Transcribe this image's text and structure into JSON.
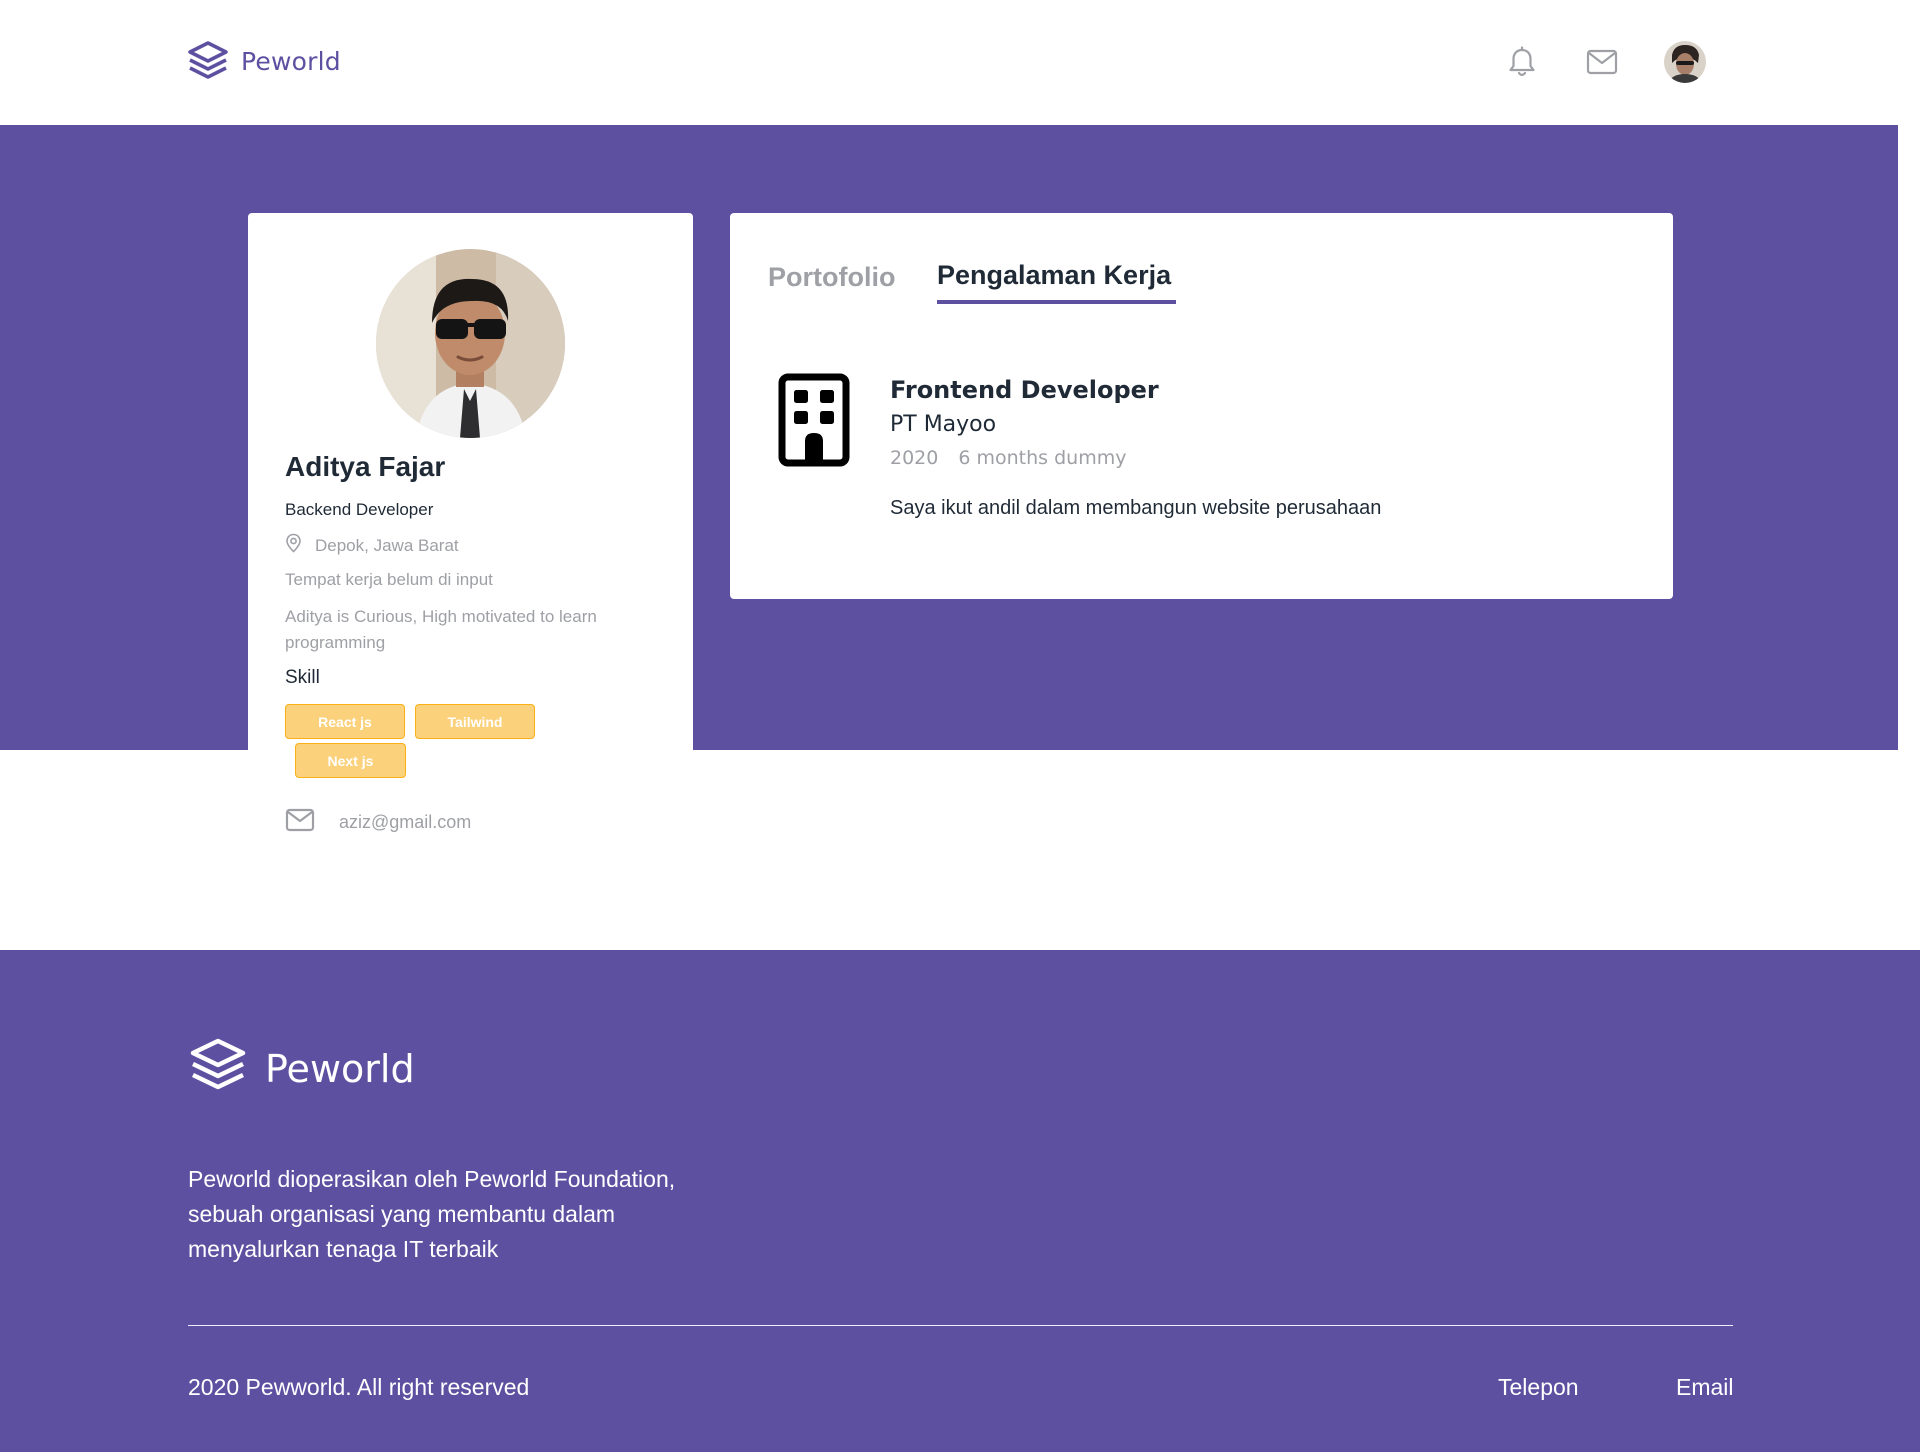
{
  "navbar": {
    "brand_name": "Peworld",
    "icons": [
      "bell-icon",
      "mail-icon"
    ],
    "avatar": "user-avatar"
  },
  "profile": {
    "name": "Aditya Fajar",
    "role": "Backend Developer",
    "location": "Depok, Jawa Barat",
    "workplace": "Tempat kerja belum di input",
    "bio": "Aditya is Curious, High motivated to learn programming",
    "skill_heading": "Skill",
    "skills": [
      "React js",
      "Tailwind",
      "Next js"
    ],
    "email": "aziz@gmail.com"
  },
  "tabs": [
    {
      "label": "Portofolio",
      "active": false
    },
    {
      "label": "Pengalaman Kerja",
      "active": true
    }
  ],
  "experience": {
    "position": "Frontend Developer",
    "company": "PT Mayoo",
    "year": "2020",
    "duration": "6 months dummy",
    "description": "Saya ikut andil dalam membangun website perusahaan"
  },
  "footer": {
    "brand_name": "Peworld",
    "description": "Peworld dioperasikan oleh Peworld Foundation, sebuah organisasi yang membantu dalam menyalurkan tenaga IT terbaik",
    "copyright": "2020 Pewworld. All right reserved",
    "links": [
      "Telepon",
      "Email"
    ]
  },
  "colors": {
    "primary": "#5E50A1",
    "skill_chip": "#FBD17B",
    "skill_chip_border": "#FBB017",
    "muted_text": "#9EA0A5",
    "dark_text": "#1F2A36"
  }
}
